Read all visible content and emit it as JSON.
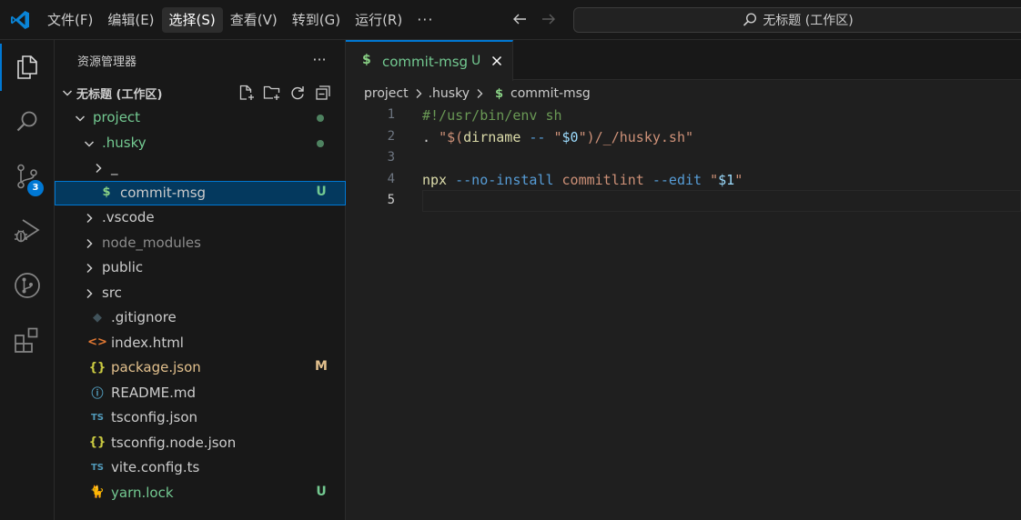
{
  "titlebar": {
    "menu": [
      "文件(F)",
      "编辑(E)",
      "选择(S)",
      "查看(V)",
      "转到(G)",
      "运行(R)"
    ],
    "active_menu_index": 2,
    "more_label": "···",
    "command_center": "无标题 (工作区)"
  },
  "activitybar": {
    "items": [
      "explorer-icon",
      "search-icon",
      "source-control-icon",
      "run-debug-icon",
      "git-graph-icon",
      "extensions-icon"
    ],
    "source_control_badge": "3"
  },
  "sidebar": {
    "title": "资源管理器",
    "more_label": "···",
    "workspace_title": "无标题 (工作区)",
    "tree": [
      {
        "name": "project",
        "type": "folder",
        "open": true,
        "depth": 0,
        "color": "#73c991",
        "indicator": "dot"
      },
      {
        "name": ".husky",
        "type": "folder",
        "open": true,
        "depth": 1,
        "color": "#73c991",
        "indicator": "dot"
      },
      {
        "name": "_",
        "type": "folder",
        "open": false,
        "depth": 2,
        "color": "#cccccc"
      },
      {
        "name": "commit-msg",
        "type": "file",
        "icon": "$",
        "icon_color": "#89d185",
        "depth": 2,
        "color": "#cccccc",
        "status": "U",
        "status_color": "#73c991",
        "selected": true
      },
      {
        "name": ".vscode",
        "type": "folder",
        "open": false,
        "depth": 1,
        "color": "#cccccc"
      },
      {
        "name": "node_modules",
        "type": "folder",
        "open": false,
        "depth": 1,
        "color": "#8c8c8c"
      },
      {
        "name": "public",
        "type": "folder",
        "open": false,
        "depth": 1,
        "color": "#cccccc"
      },
      {
        "name": "src",
        "type": "folder",
        "open": false,
        "depth": 1,
        "color": "#cccccc"
      },
      {
        "name": ".gitignore",
        "type": "file",
        "icon": "◆",
        "icon_color": "#41535b",
        "depth": 1,
        "color": "#cccccc"
      },
      {
        "name": "index.html",
        "type": "file",
        "icon": "<>",
        "icon_color": "#e37933",
        "depth": 1,
        "color": "#cccccc"
      },
      {
        "name": "package.json",
        "type": "file",
        "icon": "{}",
        "icon_color": "#cbcb41",
        "depth": 1,
        "color": "#e2c08d",
        "status": "M",
        "status_color": "#e2c08d"
      },
      {
        "name": "README.md",
        "type": "file",
        "icon": "ⓘ",
        "icon_color": "#519aba",
        "depth": 1,
        "color": "#cccccc"
      },
      {
        "name": "tsconfig.json",
        "type": "file",
        "icon": "TS",
        "icon_color": "#519aba",
        "depth": 1,
        "color": "#cccccc"
      },
      {
        "name": "tsconfig.node.json",
        "type": "file",
        "icon": "{}",
        "icon_color": "#cbcb41",
        "depth": 1,
        "color": "#cccccc"
      },
      {
        "name": "vite.config.ts",
        "type": "file",
        "icon": "TS",
        "icon_color": "#519aba",
        "depth": 1,
        "color": "#cccccc"
      },
      {
        "name": "yarn.lock",
        "type": "file",
        "icon": "🐈",
        "icon_color": "#519aba",
        "depth": 1,
        "color": "#73c991",
        "status": "U",
        "status_color": "#73c991"
      }
    ]
  },
  "editor": {
    "tab": {
      "icon": "$",
      "label": "commit-msg",
      "status": "U"
    },
    "breadcrumb": [
      "project",
      ".husky",
      "commit-msg"
    ],
    "breadcrumb_file_icon": "$",
    "current_line": 5,
    "lines": [
      {
        "number": "1",
        "tokens": [
          {
            "t": "#!/usr/bin/env sh",
            "c": "t-comment"
          }
        ]
      },
      {
        "number": "2",
        "tokens": [
          {
            "t": ". ",
            "c": "t-plain"
          },
          {
            "t": "\"$(",
            "c": "t-str"
          },
          {
            "t": "dirname",
            "c": "t-func"
          },
          {
            "t": " -- ",
            "c": "t-param"
          },
          {
            "t": "\"",
            "c": "t-str"
          },
          {
            "t": "$0",
            "c": "t-var"
          },
          {
            "t": "\"",
            "c": "t-str"
          },
          {
            "t": ")/_/husky.sh\"",
            "c": "t-str"
          }
        ]
      },
      {
        "number": "3",
        "tokens": []
      },
      {
        "number": "4",
        "tokens": [
          {
            "t": "npx",
            "c": "t-func"
          },
          {
            "t": " --no-install ",
            "c": "t-param"
          },
          {
            "t": "commitlint",
            "c": "t-str"
          },
          {
            "t": " --edit ",
            "c": "t-param"
          },
          {
            "t": "\"",
            "c": "t-str"
          },
          {
            "t": "$1",
            "c": "t-var"
          },
          {
            "t": "\"",
            "c": "t-str"
          }
        ]
      },
      {
        "number": "5",
        "tokens": []
      }
    ]
  }
}
